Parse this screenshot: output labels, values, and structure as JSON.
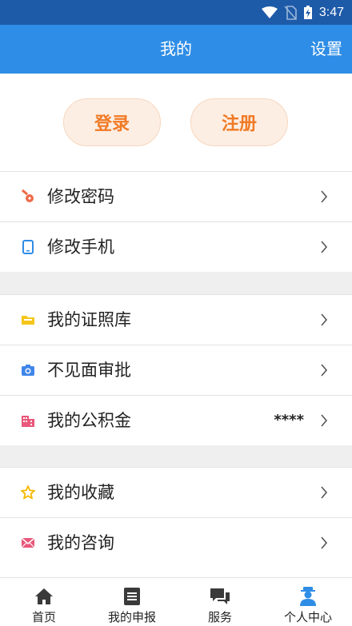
{
  "status_bar": {
    "time": "3:47"
  },
  "header": {
    "title": "我的",
    "settings": "设置"
  },
  "auth": {
    "login": "登录",
    "register": "注册"
  },
  "menu_group_1": [
    {
      "label": "修改密码",
      "icon": "key-icon"
    },
    {
      "label": "修改手机",
      "icon": "phone-icon"
    }
  ],
  "menu_group_2": [
    {
      "label": "我的证照库",
      "icon": "folder-icon"
    },
    {
      "label": "不见面审批",
      "icon": "camera-icon"
    },
    {
      "label": "我的公积金",
      "icon": "building-icon",
      "value": "****"
    }
  ],
  "menu_group_3": [
    {
      "label": "我的收藏",
      "icon": "star-icon"
    },
    {
      "label": "我的咨询",
      "icon": "mail-icon"
    }
  ],
  "tabs": [
    {
      "label": "首页",
      "icon": "home-icon"
    },
    {
      "label": "我的申报",
      "icon": "document-icon"
    },
    {
      "label": "服务",
      "icon": "chat-icon"
    },
    {
      "label": "个人中心",
      "icon": "user-icon",
      "active": true
    }
  ],
  "colors": {
    "header": "#2e8de6",
    "status_bar": "#1d5aa8",
    "auth_text": "#f07a25",
    "auth_bg": "#fdeee3"
  }
}
